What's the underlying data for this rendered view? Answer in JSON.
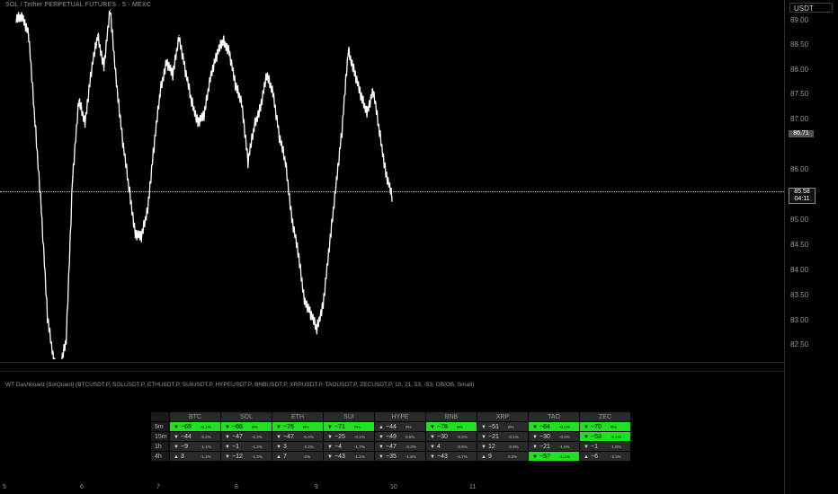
{
  "symbol_title": "SOL / Tether PERPETUAL FUTURES · 5 · MEXC",
  "currency": "USDT",
  "price_ticks": [
    "89.00",
    "88.50",
    "88.00",
    "87.50",
    "87.00",
    "86.00",
    "85.00",
    "84.50",
    "84.00",
    "83.50",
    "83.00",
    "82.50"
  ],
  "price_label_high": "86.71",
  "price_label_current": "85.58",
  "countdown": "04:11",
  "indicator_title": "WT Dashboard [SolQuant] (BTCUSDT.P, SOLUSDT.P, ETHUSDT.P, SUIUSDT.P, HYPEUSDT.P, BNBUSDT.P, XRPUSDT.P, TAOUSDT.P, ZECUSDT.P, 10, 21, 53, -53, OB/OS, Small)",
  "dashboard": {
    "columns": [
      "BTC",
      "SOL",
      "ETH",
      "SUI",
      "HYPE",
      "BNB",
      "XRP",
      "TAO",
      "ZEC"
    ],
    "rows": [
      {
        "label": "5m",
        "cells": [
          {
            "dir": "▼",
            "val": "−69",
            "pct": "-0.1%",
            "hi": true
          },
          {
            "dir": "▼",
            "val": "−66",
            "pct": "0%",
            "hi": true
          },
          {
            "dir": "▼",
            "val": "−76",
            "pct": "0%",
            "hi": true
          },
          {
            "dir": "▼",
            "val": "−71",
            "pct": "0%",
            "hi": true
          },
          {
            "dir": "▲",
            "val": "−44",
            "pct": "0%",
            "hi": false
          },
          {
            "dir": "▼",
            "val": "−78",
            "pct": "0%",
            "hi": true
          },
          {
            "dir": "▼",
            "val": "−51",
            "pct": "0%",
            "hi": false
          },
          {
            "dir": "▼",
            "val": "−64",
            "pct": "-0.1%",
            "hi": true
          },
          {
            "dir": "▼",
            "val": "−70",
            "pct": "0%",
            "hi": true
          }
        ]
      },
      {
        "label": "15m",
        "cells": [
          {
            "dir": "▼",
            "val": "−44",
            "pct": "-0.2%",
            "hi": false
          },
          {
            "dir": "▼",
            "val": "−47",
            "pct": "-0.3%",
            "hi": false
          },
          {
            "dir": "▼",
            "val": "−47",
            "pct": "-0.4%",
            "hi": false
          },
          {
            "dir": "▼",
            "val": "−25",
            "pct": "-0.1%",
            "hi": false
          },
          {
            "dir": "▼",
            "val": "−49",
            "pct": "0.5%",
            "hi": false
          },
          {
            "dir": "▼",
            "val": "−30",
            "pct": "-0.2%",
            "hi": false
          },
          {
            "dir": "▼",
            "val": "−21",
            "pct": "-0.1%",
            "hi": false
          },
          {
            "dir": "▼",
            "val": "−30",
            "pct": "-0.2%",
            "hi": false
          },
          {
            "dir": "▼",
            "val": "−53",
            "pct": "-0.1%",
            "hi": true
          }
        ]
      },
      {
        "label": "1h",
        "cells": [
          {
            "dir": "▼",
            "val": "−9",
            "pct": "-1.1%",
            "hi": false
          },
          {
            "dir": "▼",
            "val": "−1",
            "pct": "-1.2%",
            "hi": false
          },
          {
            "dir": "▼",
            "val": "3",
            "pct": "-2.2%",
            "hi": false
          },
          {
            "dir": "▼",
            "val": "−4",
            "pct": "-1.7%",
            "hi": false
          },
          {
            "dir": "▼",
            "val": "−47",
            "pct": "-0.3%",
            "hi": false
          },
          {
            "dir": "▼",
            "val": "4",
            "pct": "-0.9%",
            "hi": false
          },
          {
            "dir": "▼",
            "val": "12",
            "pct": "-0.9%",
            "hi": false
          },
          {
            "dir": "▼",
            "val": "−21",
            "pct": "-1.6%",
            "hi": false
          },
          {
            "dir": "▼",
            "val": "−1",
            "pct": "-1.8%",
            "hi": false
          }
        ]
      },
      {
        "label": "4h",
        "cells": [
          {
            "dir": "▲",
            "val": "3",
            "pct": "-1.2%",
            "hi": false
          },
          {
            "dir": "▼",
            "val": "−12",
            "pct": "-1.3%",
            "hi": false
          },
          {
            "dir": "▲",
            "val": "7",
            "pct": "-2%",
            "hi": false
          },
          {
            "dir": "▼",
            "val": "−43",
            "pct": "-1.2%",
            "hi": false
          },
          {
            "dir": "▼",
            "val": "−35",
            "pct": "-1.8%",
            "hi": false
          },
          {
            "dir": "▼",
            "val": "−43",
            "pct": "-0.7%",
            "hi": false
          },
          {
            "dir": "▲",
            "val": "9",
            "pct": "0.2%",
            "hi": false
          },
          {
            "dir": "▼",
            "val": "−57",
            "pct": "-1.1%",
            "hi": true
          },
          {
            "dir": "▲",
            "val": "−6",
            "pct": "-2.3%",
            "hi": false
          }
        ]
      }
    ]
  },
  "time_labels": [
    "5",
    "6",
    "7",
    "8",
    "9",
    "10",
    "11"
  ],
  "colors": {
    "highlight": "#1fe11f",
    "background": "#000000",
    "price_line": "#ffffff"
  },
  "chart_data": {
    "type": "line",
    "series": [
      {
        "values": [
          88.9,
          89.0,
          88.6,
          86.9,
          85.2,
          83.0,
          82.2,
          82.0,
          82.6,
          85.8,
          87.3,
          86.9,
          87.9,
          88.6,
          88.0,
          89.1,
          87.7,
          86.5,
          85.6,
          84.7,
          84.6,
          85.2,
          86.4,
          87.5,
          88.1,
          87.8,
          88.6,
          87.9,
          87.3,
          86.9,
          87.0,
          87.8,
          88.2,
          88.5,
          88.3,
          87.6,
          87.3,
          86.1,
          86.8,
          87.2,
          87.8,
          87.5,
          86.6,
          86.1,
          85.0,
          84.3,
          83.4,
          83.1,
          82.8,
          83.3,
          84.4,
          85.6,
          86.7,
          88.3,
          87.9,
          87.4,
          87.1,
          87.5,
          86.7,
          85.9,
          85.4
        ]
      }
    ],
    "ylim": [
      82.2,
      89.3
    ]
  }
}
